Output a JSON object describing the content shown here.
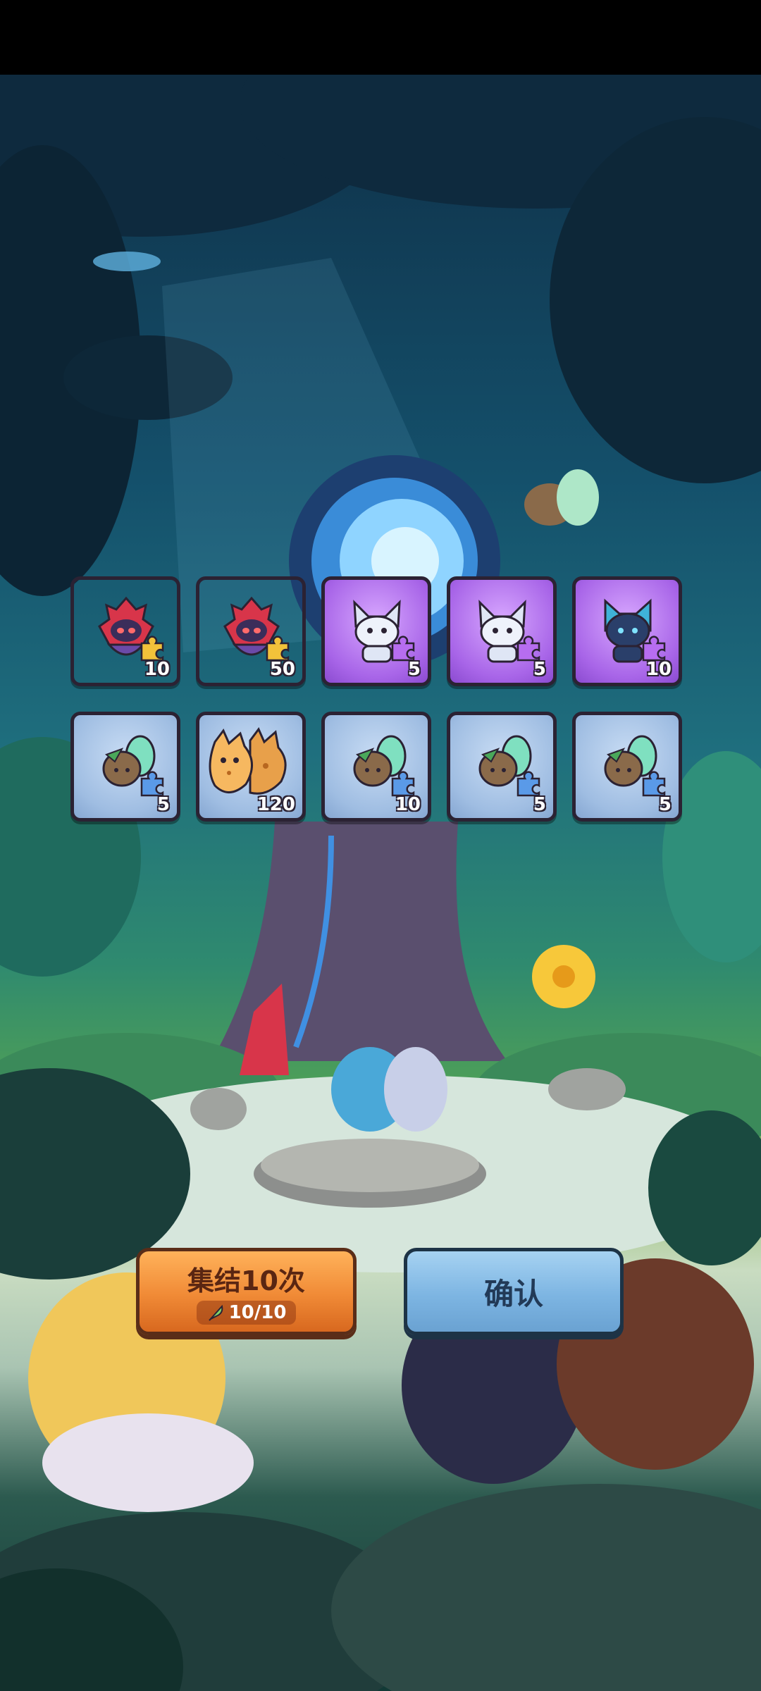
{
  "rewards_row1": [
    {
      "rarity": "gold",
      "character": "red-hooded-mage",
      "puzzle_color": "#f2c23a",
      "quantity": "10"
    },
    {
      "rarity": "gold",
      "character": "red-hooded-mage",
      "puzzle_color": "#f2c23a",
      "quantity": "50"
    },
    {
      "rarity": "purple",
      "character": "white-wolf",
      "puzzle_color": "#b76df0",
      "quantity": "5"
    },
    {
      "rarity": "purple",
      "character": "white-wolf",
      "puzzle_color": "#b76df0",
      "quantity": "5"
    },
    {
      "rarity": "purple",
      "character": "blue-cat-ninja",
      "puzzle_color": "#b76df0",
      "quantity": "10"
    }
  ],
  "rewards_row2": [
    {
      "rarity": "blue",
      "character": "moth-fairy",
      "puzzle_color": "#5a9ae8",
      "quantity": "5"
    },
    {
      "rarity": "blue",
      "character": "cat-cookies",
      "puzzle_color": "",
      "quantity": "120"
    },
    {
      "rarity": "blue",
      "character": "moth-fairy",
      "puzzle_color": "#5a9ae8",
      "quantity": "10"
    },
    {
      "rarity": "blue",
      "character": "moth-fairy",
      "puzzle_color": "#5a9ae8",
      "quantity": "5"
    },
    {
      "rarity": "blue",
      "character": "moth-fairy",
      "puzzle_color": "#5a9ae8",
      "quantity": "5"
    }
  ],
  "buttons": {
    "gather": {
      "label": "集结10次",
      "count": "10/10",
      "icon": "feather-icon"
    },
    "confirm": {
      "label": "确认"
    }
  }
}
